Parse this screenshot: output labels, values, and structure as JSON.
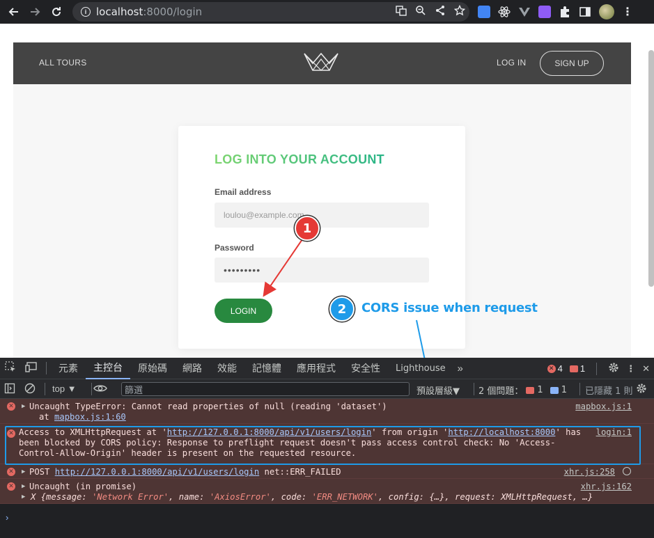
{
  "browser": {
    "url_host": "localhost",
    "url_rest": ":8000/login"
  },
  "site": {
    "nav_all_tours": "ALL TOURS",
    "nav_login": "LOG IN",
    "nav_signup": "SIGN UP",
    "form_title": "LOG INTO YOUR ACCOUNT",
    "email_label": "Email address",
    "email_placeholder": "loulou@example.com",
    "password_label": "Password",
    "password_value": "•••••••••",
    "login_button": "LOGIN"
  },
  "annotations": {
    "badge1": "1",
    "badge2": "2",
    "note2": "CORS issue when request"
  },
  "devtools": {
    "tabs": [
      "元素",
      "主控台",
      "原始碼",
      "網路",
      "效能",
      "記憶體",
      "應用程式",
      "安全性",
      "Lighthouse"
    ],
    "active_tab": "主控台",
    "error_count": "4",
    "issue_count": "1",
    "context": "top",
    "filter_placeholder": "篩選",
    "levels": "預設層級",
    "issues_label": "2 個問題：",
    "issues_red": "1",
    "issues_blue": "1",
    "hidden": "已隱藏 1 則",
    "messages": [
      {
        "line1": "Uncaught TypeError: Cannot read properties of null (reading 'dataset')",
        "line2_prefix": "at ",
        "line2_link": "mapbox.js:1:60",
        "source": "mapbox.js:1"
      },
      {
        "t1": "Access to XMLHttpRequest at '",
        "link1": "http://127.0.0.1:8000/api/v1/users/login",
        "t2": "' from origin '",
        "link2": "http://localhost:8000",
        "t3": "' has been blocked by CORS policy: Response to preflight request doesn't pass access control check: No 'Access-Control-Allow-Origin' header is present on the requested resource.",
        "source": "login:1"
      },
      {
        "prefix": "POST ",
        "link": "http://127.0.0.1:8000/api/v1/users/login",
        "suffix": " net::ERR_FAILED",
        "source": "xhr.js:258"
      },
      {
        "line1": "Uncaught (in promise)",
        "source": "xhr.js:162",
        "obj_prefix": "X {",
        "k1": "message: ",
        "v1": "'Network Error'",
        "k2": ", name: ",
        "v2": "'AxiosError'",
        "k3": ", code: ",
        "v3": "'ERR_NETWORK'",
        "k4": ", config: ",
        "v4": "{…}",
        "k5": ", request: ",
        "v5": "XMLHttpRequest, …}"
      }
    ]
  }
}
